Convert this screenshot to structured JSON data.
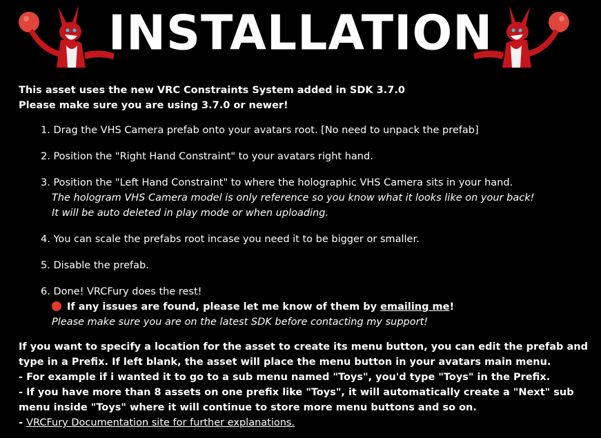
{
  "header": {
    "title": "INSTALLATION"
  },
  "intro": [
    "This asset uses the new VRC Constraints System added in SDK 3.7.0",
    "Please make sure you are using 3.7.0 or newer!"
  ],
  "steps": {
    "s1": "1. Drag the VHS Camera prefab onto your avatars root. [No need to unpack the prefab]",
    "s2": "2. Position the \"Right Hand Constraint\" to your avatars right hand.",
    "s3": "3. Position the \"Left Hand Constraint\" to where the holographic VHS Camera sits in your hand.",
    "s3_note1": "The hologram VHS Camera model is only reference so you know what it looks like on your back!",
    "s3_note2": "It will be auto deleted in play mode or when uploading.",
    "s4": "4. You can scale the prefabs root incase you need it to be bigger or smaller.",
    "s5": "5. Disable the prefab.",
    "s6": "6. Done! VRCFury does the rest!",
    "s6_warn_pre": "If any issues are found, please let me know of them by ",
    "s6_warn_link": "emailing me",
    "s6_warn_post": "!",
    "s6_note": "Please make sure you are on the latest SDK before contacting my support!"
  },
  "footer": {
    "p1": "If you want to specify a location for the asset to create its menu button, you can edit the prefab and type in a Prefix. If left blank, the asset will place the menu button in your avatars main menu.",
    "p2": "- For example if i wanted it to go to a sub menu named \"Toys\", you'd type \"Toys\" in the Prefix.",
    "p3": "- If you have more than 8 assets on one prefix like \"Toys\", it will automatically create a \"Next\" sub menu inside \"Toys\" where it will continue to store more menu buttons and so on.",
    "p4_prefix": "- ",
    "p4_link": "VRCFury Documentation site for further explanations."
  },
  "colors": {
    "background": "#000000",
    "text": "#ffffff",
    "warning_dot": "#e23b2a",
    "mascot_fur": "#c4161c",
    "ball": "#e0453a"
  }
}
